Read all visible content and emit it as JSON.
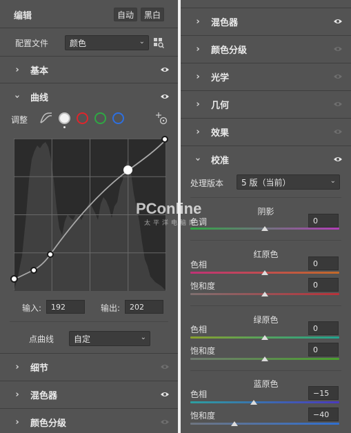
{
  "left": {
    "edit_title": "编辑",
    "auto_button": "自动",
    "bw_button": "黑白",
    "profile_label": "配置文件",
    "profile_value": "颜色",
    "basic": "基本",
    "curve": "曲线",
    "adjust_label": "调整",
    "input_label": "输入:",
    "input_value": "192",
    "output_label": "输出:",
    "output_value": "202",
    "point_curve_label": "点曲线",
    "point_curve_value": "自定",
    "detail": "细节",
    "mixer": "混色器",
    "color_grading": "颜色分级"
  },
  "right": {
    "mixer": "混色器",
    "color_grading": "颜色分级",
    "optics": "光学",
    "geometry": "几何",
    "effects": "效果",
    "calibration": "校准",
    "process_label": "处理版本",
    "process_value": "5 版（当前）",
    "shadows_title": "阴影",
    "tint_label": "色调",
    "tint_value": "0",
    "red_title": "红原色",
    "red_hue_label": "色相",
    "red_hue_value": "0",
    "red_sat_label": "饱和度",
    "red_sat_value": "0",
    "green_title": "绿原色",
    "green_hue_label": "色相",
    "green_hue_value": "0",
    "green_sat_label": "饱和度",
    "green_sat_value": "0",
    "blue_title": "蓝原色",
    "blue_hue_label": "色相",
    "blue_hue_value": "−15",
    "blue_sat_label": "饱和度",
    "blue_sat_value": "−40"
  },
  "watermark": {
    "logo": "PConline",
    "sub": "太平洋电脑网"
  },
  "icons": {
    "eye": "eye-icon",
    "chevron_right": "chevron-right-icon",
    "chevron_down": "chevron-down-icon",
    "grid": "profile-browser-icon",
    "target": "targeted-adjustment-icon"
  },
  "colors": {
    "panel_bg": "#535353",
    "red_channel": "#e0252b",
    "green_channel": "#2fa844",
    "blue_channel": "#2d6fe0"
  }
}
